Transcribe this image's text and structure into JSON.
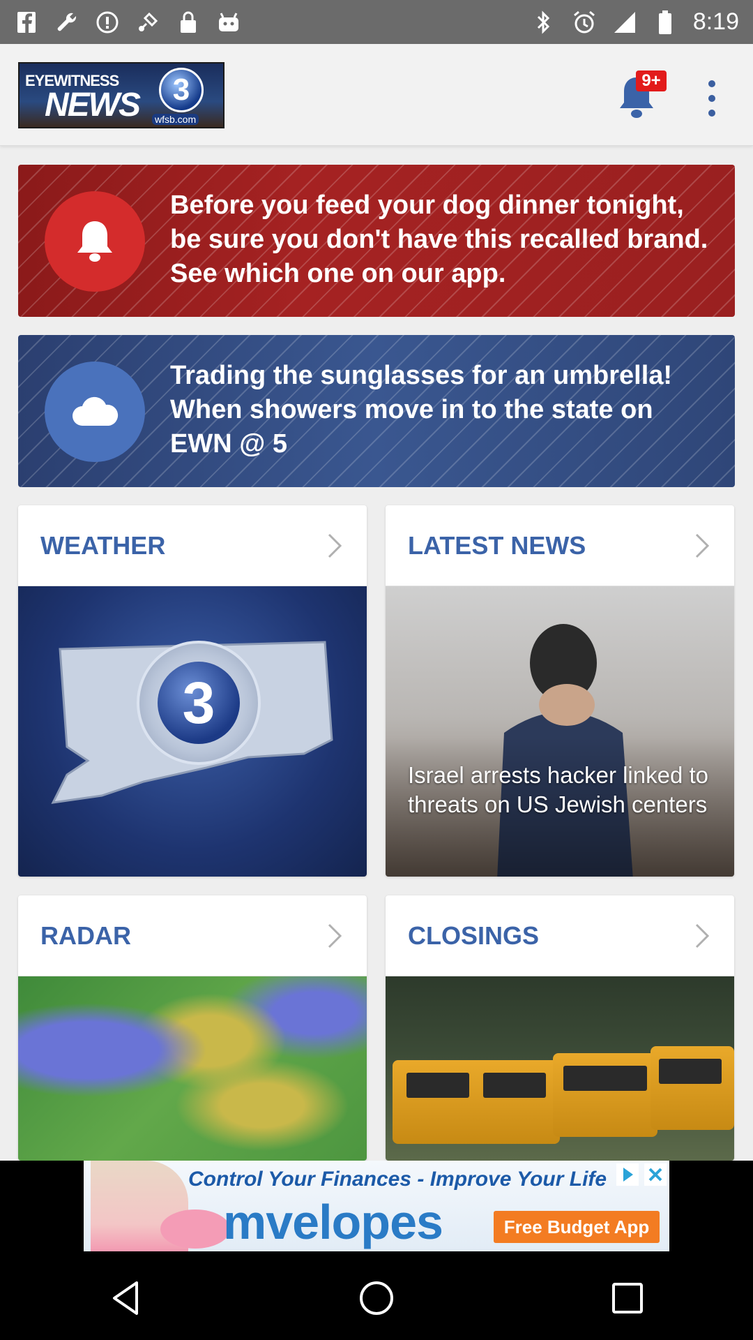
{
  "status_bar": {
    "time": "8:19",
    "icons_left": [
      "facebook-icon",
      "wrench-icon",
      "alert-icon",
      "fake-gps-icon",
      "lock-icon",
      "robot-icon"
    ],
    "icons_right": [
      "bluetooth-icon",
      "alarm-icon",
      "signal-icon",
      "battery-icon"
    ]
  },
  "app_bar": {
    "logo": {
      "line1": "EYEWITNESS",
      "line2": "NEWS",
      "number": "3",
      "site": "wfsb.com"
    },
    "notification_badge": "9+"
  },
  "alerts": [
    {
      "text": "Before you feed your dog dinner tonight, be sure you don't have this recalled brand. See which one on our app.",
      "icon": "bell-icon",
      "color": "#a52222"
    },
    {
      "text": "Trading the sunglasses for an umbrella! When showers move in to the state on EWN @ 5",
      "icon": "cloud-icon",
      "color": "#3a5790"
    }
  ],
  "tiles": {
    "weather": {
      "title": "WEATHER"
    },
    "latest_news": {
      "title": "LATEST NEWS",
      "caption": "Israel arrests hacker linked to threats on US Jewish centers"
    },
    "radar": {
      "title": "RADAR"
    },
    "closings": {
      "title": "CLOSINGS"
    }
  },
  "ad": {
    "headline": "Control Your Finances - Improve Your Life",
    "brand": "mvelopes",
    "cta": "Free Budget App"
  },
  "colors": {
    "accent": "#3b63a8",
    "status_bar": "#6b6b6b",
    "badge": "#e21b1b"
  }
}
